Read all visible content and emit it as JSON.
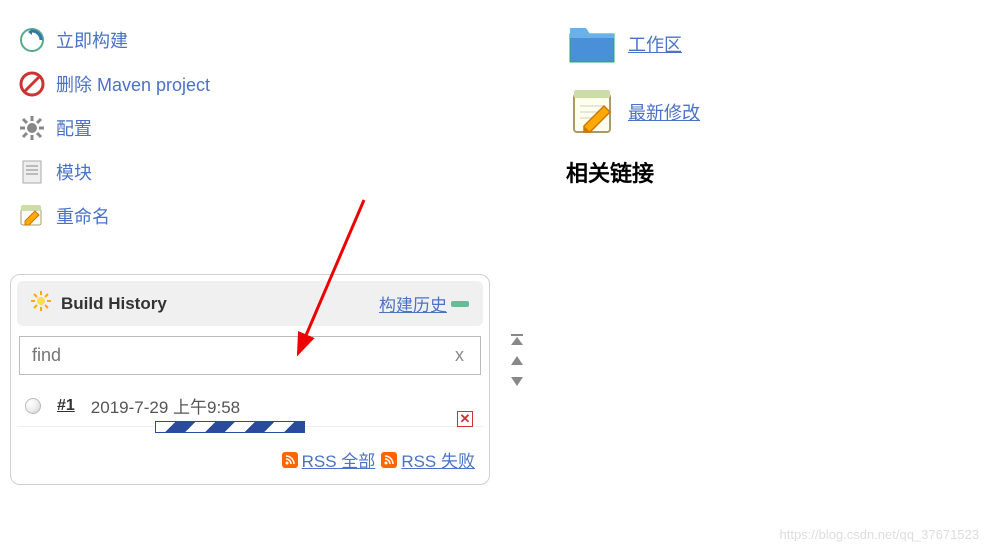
{
  "sidebar": {
    "items": [
      {
        "label": "立即构建",
        "icon": "build-now-icon"
      },
      {
        "label": "删除 Maven project",
        "icon": "delete-icon"
      },
      {
        "label": "配置",
        "icon": "configure-icon"
      },
      {
        "label": "模块",
        "icon": "modules-icon"
      },
      {
        "label": "重命名",
        "icon": "rename-icon"
      }
    ]
  },
  "right": {
    "workspace_label": "工作区",
    "recent_changes_label": "最新修改",
    "related_links_heading": "相关链接"
  },
  "build_history": {
    "title": "Build History",
    "trend_link": "构建历史",
    "search_placeholder": "find",
    "search_clear": "x",
    "builds": [
      {
        "number": "#1",
        "timestamp": "2019-7-29 上午9:58"
      }
    ],
    "rss_all": "RSS 全部",
    "rss_failed": "RSS 失败"
  },
  "watermark": "https://blog.csdn.net/qq_37671523"
}
